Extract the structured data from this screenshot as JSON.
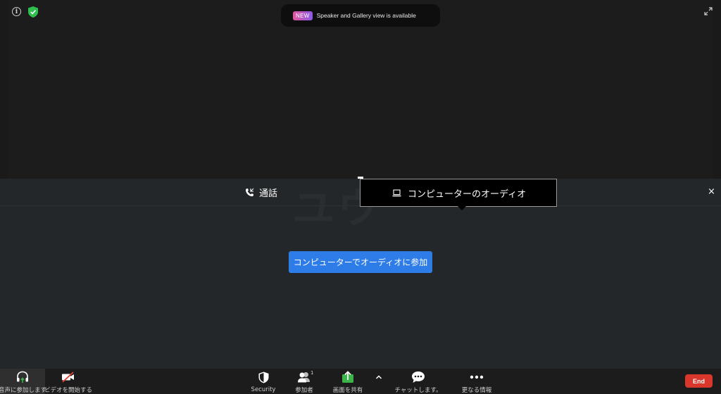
{
  "banner": {
    "badge": "NEW",
    "text": "Speaker and Gallery view is available"
  },
  "info_glyph": "i",
  "audio_panel": {
    "watermark": "ユウ",
    "tab_phone_label": "通話",
    "tab_computer_label": "コンピューターのオーディオ",
    "close_glyph": "×",
    "join_button_label": "コンピューターでオーディオに参加"
  },
  "toolbar": {
    "audio_label": "音声に参加します",
    "video_label": "ビデオを開始する",
    "security_label": "Security",
    "participants_label": "参加者",
    "participants_count": "1",
    "share_label": "画面を共有",
    "caret_glyph": "^",
    "chat_label": "チャットします。",
    "more_label": "更なる情報",
    "end_label": "End"
  },
  "colors": {
    "join_button": "#2d7ce8",
    "end_button": "#d9372b",
    "share_icon": "#3bb54a",
    "audio_icon": "#3bb54a",
    "shield": "#2fbf4e"
  },
  "icons": [
    "info-icon",
    "shield-icon",
    "expand-icon",
    "phone-icon",
    "laptop-icon",
    "headphone-icon",
    "video-off-icon",
    "security-shield-icon",
    "participants-icon",
    "share-screen-icon",
    "caret-up-icon",
    "chat-icon",
    "more-icon"
  ]
}
